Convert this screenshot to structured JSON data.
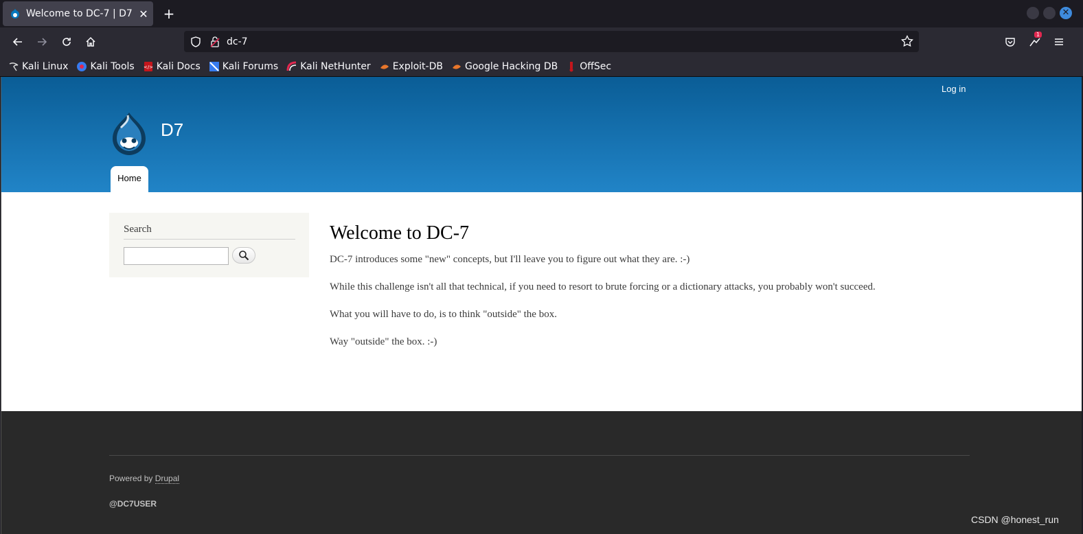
{
  "browser": {
    "tab_title": "Welcome to DC-7 | D7",
    "tab_close": "✕",
    "new_tab": "+",
    "url": "dc-7",
    "bookmarks": [
      "Kali Linux",
      "Kali Tools",
      "Kali Docs",
      "Kali Forums",
      "Kali NetHunter",
      "Exploit-DB",
      "Google Hacking DB",
      "OffSec"
    ],
    "extension_badge": "1"
  },
  "site": {
    "login": "Log in",
    "name": "D7",
    "nav_home": "Home",
    "sidebar_title": "Search",
    "heading": "Welcome to DC-7",
    "paragraphs": [
      "DC-7 introduces some \"new\" concepts, but I'll leave you to figure out what they are.  :-)",
      "While this challenge isn't all that technical, if you need to resort to brute forcing or a dictionary attacks, you probably won't succeed.",
      "What you will have to do, is to think \"outside\" the box.",
      "Way \"outside\" the box.  :-)"
    ],
    "powered_prefix": "Powered by ",
    "powered_link": "Drupal",
    "footer_user": "@DC7USER"
  },
  "watermark": "CSDN @honest_run",
  "colors": {
    "header_top": "#0a5d96",
    "header_bottom": "#2184c7",
    "footer_bg": "#292929",
    "sidebar_bg": "#f6f6f2"
  }
}
